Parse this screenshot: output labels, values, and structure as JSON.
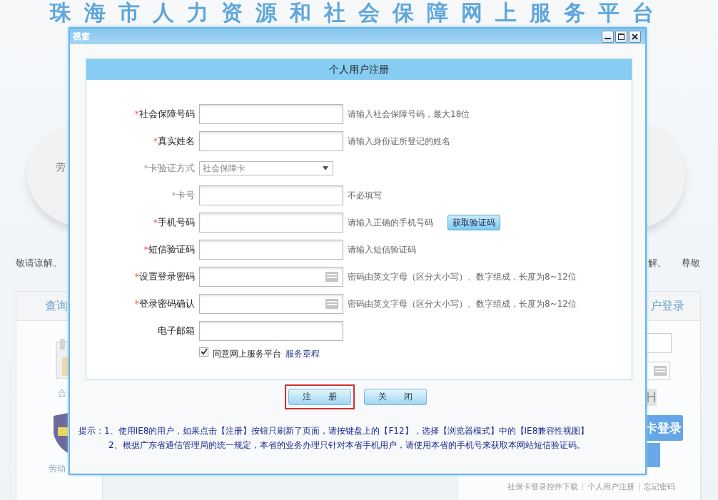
{
  "page": {
    "site_title": "珠海市人力资源和社会保障网上服务平台",
    "left": {
      "fragment": "劳",
      "notice": "敬请谅解。",
      "panel_title": "查询",
      "item_1": "合",
      "item_2": "劳动"
    },
    "right": {
      "notice_1": "解。",
      "notice_2": "尊敬",
      "panel_title": "户登录",
      "captcha": "H",
      "login_button": "卡登录"
    },
    "footer_links": [
      "社保卡登录控件下载",
      "个人用户注册",
      "忘记密码"
    ]
  },
  "dialog": {
    "title": "视窗",
    "heading": "个人用户注册",
    "fields": [
      {
        "label": "社会保障号码",
        "kind": "text",
        "marker": "*",
        "disabled": false,
        "hint": "请输入社会保障号码，最大18位"
      },
      {
        "label": "真实姓名",
        "kind": "text",
        "marker": "*",
        "disabled": false,
        "hint": "请输入身份证所登记的姓名"
      },
      {
        "label": "卡验证方式",
        "kind": "select",
        "marker": "*",
        "disabled": true,
        "value": "社会保障卡"
      },
      {
        "label": "卡号",
        "kind": "text",
        "marker": "*",
        "disabled": true,
        "hint": "不必填写"
      },
      {
        "label": "手机号码",
        "kind": "text",
        "marker": "*",
        "disabled": false,
        "hint": "请输入正确的手机号码",
        "action": "获取验证码"
      },
      {
        "label": "短信验证码",
        "kind": "text",
        "marker": "*",
        "disabled": false,
        "hint": "请输入短信验证码"
      },
      {
        "label": "设置登录密码",
        "kind": "password",
        "marker": "*",
        "disabled": false,
        "hint": "密码由英文字母（区分大小写）、数字组成，长度为8~12位"
      },
      {
        "label": "登录密码确认",
        "kind": "password",
        "marker": "*",
        "disabled": false,
        "hint": "密码由英文字母（区分大小写）、数字组成，长度为8~12位"
      },
      {
        "label": "电子邮箱",
        "kind": "text",
        "disabled": false
      }
    ],
    "agree": {
      "checked": true,
      "text": "同意网上服务平台",
      "link": "服务章程"
    },
    "buttons": [
      {
        "label": "注　　册",
        "highlighted": true
      },
      {
        "label": "关　　闭",
        "highlighted": false
      }
    ],
    "tips": [
      "提示：1、使用IE8的用户，如果点击【注册】按钮只刷新了页面，请按键盘上的【F12】，选择【浏览器模式】中的【IE8兼容性视图】",
      "2、根据广东省通信管理局的统一规定，本省的业务办理只针对本省手机用户，请使用本省的手机号来获取本网站短信验证码。"
    ]
  }
}
